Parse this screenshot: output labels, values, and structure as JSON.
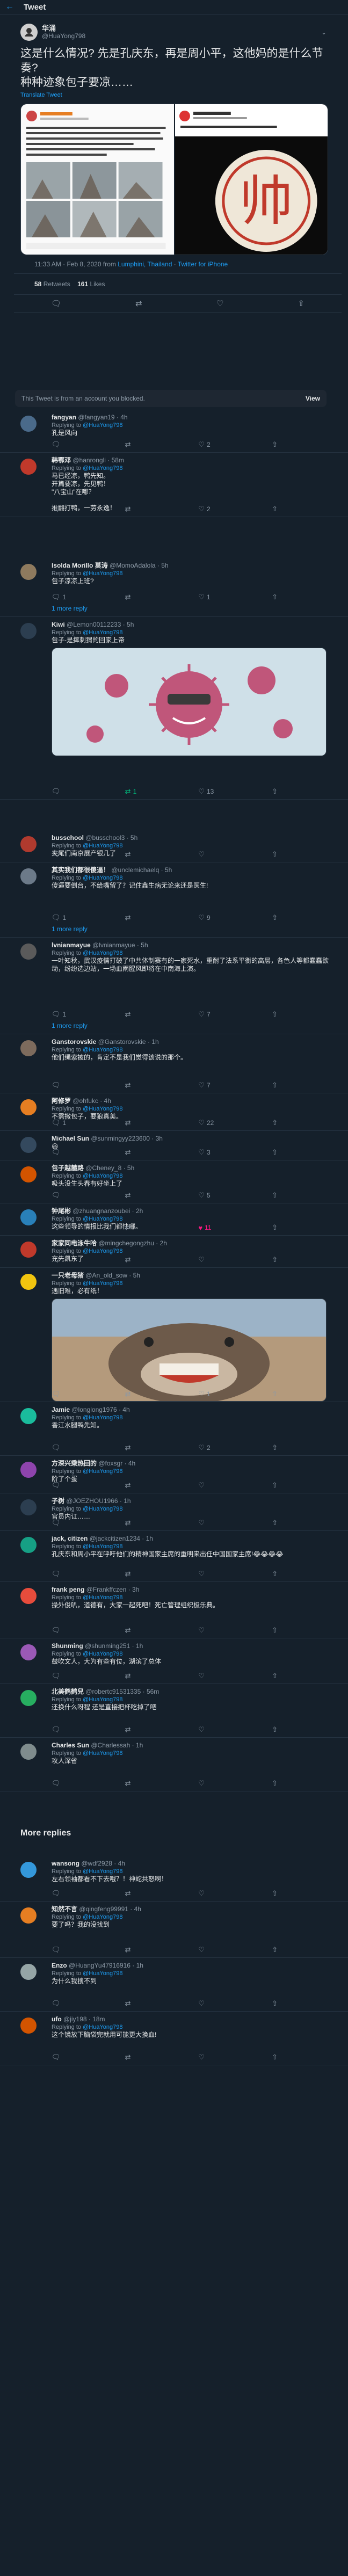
{
  "topbar": {
    "title": "Tweet",
    "back_icon": "arrow-left-icon"
  },
  "main_tweet": {
    "author_name": "华涌",
    "author_handle": "@HuaYong798",
    "text": "这是什么情况? 先是孔庆东，再是周小平，这他妈的是什么节奏?\n种种迹象包子要凉……",
    "translate": "Translate Tweet",
    "timestamp": "11:33 AM · Feb 8, 2020 from",
    "location": "Lumphini, Thailand",
    "source": "Twitter for iPhone",
    "retweets": "58",
    "retweets_label": "Retweets",
    "likes": "161",
    "likes_label": "Likes"
  },
  "blocked": {
    "text": "This Tweet is from an account you blocked.",
    "view": "View"
  },
  "more_replies_title": "More replies",
  "replies": [
    {
      "name": "fangyan",
      "handle": "@fangyan19 · 4h",
      "to": "@HuaYong798",
      "text": "孔是风向",
      "reply": "",
      "rt": "",
      "like": "2",
      "liked": false,
      "rted": false,
      "more": false
    },
    {
      "name": "韩鄂邓",
      "handle": "@hanrongli · 58m",
      "to": "@HuaYong798",
      "text": "马已经凉，鸭先知。\n开篇要凉，先见鸭！\n\"八宝山\"在哪？\n\n推翻打鸭，一劳永逸！",
      "reply": "",
      "rt": "",
      "like": "2",
      "liked": false,
      "rted": false,
      "more": false
    },
    {
      "name": "Isolda Morillo 莫涛",
      "handle": "@MomoAdalola · 5h",
      "to": "@HuaYong798",
      "text": "包子凉凉上班?",
      "reply": "1",
      "rt": "",
      "like": "1",
      "liked": false,
      "rted": false,
      "more": true,
      "more_label": "1 more reply"
    },
    {
      "name": "Kiwi",
      "handle": "@Lemon00112233 · 5h",
      "to": "@HuaYong798",
      "text": "包子-是摔刺猬的回家上帝",
      "reply": "",
      "rt": "1",
      "like": "13",
      "liked": false,
      "rted": true,
      "more": false
    },
    {
      "name": "busschool",
      "handle": "@busschool3 · 5h",
      "to": "@HuaYong798",
      "text": "夹尾们南京展产银几了",
      "reply": "",
      "rt": "",
      "like": "",
      "liked": false,
      "rted": false,
      "more": false
    },
    {
      "name": "其实我们都很傻逼！",
      "handle": "@unclemichaelq · 5h",
      "to": "@HuaYong798",
      "text": "傻逼要倒台，不给嘴留了？记住鑫生病无论来还是医生!",
      "reply": "1",
      "rt": "",
      "like": "9",
      "liked": false,
      "rted": false,
      "more": true,
      "more_label": "1 more reply"
    },
    {
      "name": "lvnianmayue",
      "handle": "@lvnianmayue · 5h",
      "to": "@HuaYong798",
      "text": "一叶知秋，武汉疫情打破了中共体制赛有的一家死水，重耐了法系平衡的高层，各色人等都蠢蠢欲动，纷纷选边站，一场血雨腥风即将在中南海上演。",
      "reply": "1",
      "rt": "",
      "like": "7",
      "liked": false,
      "rted": false,
      "more": true,
      "more_label": "1 more reply"
    },
    {
      "name": "Ganstorovskie",
      "handle": "@Ganstorovskie · 1h",
      "to": "@HuaYong798",
      "text": "他们绳索被的，肯定不是我们觉得该说的那个。",
      "reply": "",
      "rt": "",
      "like": "7",
      "liked": false,
      "rted": false,
      "more": false
    },
    {
      "name": "阿修罗",
      "handle": "@ohfukc · 4h",
      "to": "@HuaYong798",
      "text": "不需撒包子，要狼真美。",
      "reply": "1",
      "rt": "",
      "like": "22",
      "liked": false,
      "rted": false,
      "more": false
    },
    {
      "name": "Michael Sun",
      "handle": "@sunmingyy223600 · 3h",
      "to": "",
      "text": "😃",
      "reply": "",
      "rt": "",
      "like": "3",
      "liked": false,
      "rted": false,
      "more": false
    },
    {
      "name": "包子越麓路",
      "handle": "@Cheney_8 · 5h",
      "to": "@HuaYong798",
      "text": "吸头没生头春有好坐上了",
      "reply": "",
      "rt": "",
      "like": "5",
      "liked": false,
      "rted": false,
      "more": false
    },
    {
      "name": "钟尾彬",
      "handle": "@zhuangnanzoubei · 2h",
      "to": "@HuaYong798",
      "text": "这些领导的情报比我们都快哪。",
      "reply": "",
      "rt": "",
      "like": "11",
      "liked": true,
      "rted": false,
      "more": false
    },
    {
      "name": "家家同电泳牛哈",
      "handle": "@mingchegongzhu · 2h",
      "to": "@HuaYong798",
      "text": "充先凯东了",
      "reply": "",
      "rt": "",
      "like": "",
      "liked": false,
      "rted": false,
      "more": false
    },
    {
      "name": "一只老母猪",
      "handle": "@An_old_sow · 5h",
      "to": "@HuaYong798",
      "text": "遇旧难，必有纸！",
      "reply": "",
      "rt": "",
      "like": "1",
      "liked": false,
      "rted": false,
      "more": false
    },
    {
      "name": "Jamie",
      "handle": "@longlong1976 · 4h",
      "to": "@HuaYong798",
      "text": "香江水腿鸭先知。",
      "reply": "",
      "rt": "",
      "like": "2",
      "liked": false,
      "rted": false,
      "more": false
    },
    {
      "name": "方深兴乘热回的",
      "handle": "@foxsgr · 4h",
      "to": "@HuaYong798",
      "text": "阶了个蛋",
      "reply": "",
      "rt": "",
      "like": "",
      "liked": false,
      "rted": false,
      "more": false
    },
    {
      "name": "子树",
      "handle": "@JOEZHOU1966 · 1h",
      "to": "@HuaYong798",
      "text": "官员内讧……",
      "reply": "",
      "rt": "",
      "like": "",
      "liked": false,
      "rted": false,
      "more": false
    },
    {
      "name": "jack, citizen",
      "handle": "@jackcitizen1234 · 1h",
      "to": "@HuaYong798",
      "text": "孔庆东和周小平在呼吁他们的精神国家主席的重明来出任中国国家主席!😂😂😂😂",
      "reply": "",
      "rt": "",
      "like": "",
      "liked": false,
      "rted": false,
      "more": false
    },
    {
      "name": "frank peng",
      "handle": "@Frankffczen · 3h",
      "to": "@HuaYong798",
      "text": "操外俊叭，道德有，大家一起死吧！死亡管理组织极乐典。",
      "reply": "",
      "rt": "",
      "like": "",
      "liked": false,
      "rted": false,
      "more": false
    },
    {
      "name": "Shunming",
      "handle": "@shunming251 · 1h",
      "to": "@HuaYong798",
      "text": "鼓吹文人，大为有些有位，湖滨了总体",
      "reply": "",
      "rt": "",
      "like": "",
      "liked": false,
      "rted": false,
      "more": false
    },
    {
      "name": "北美鹤鹤兒",
      "handle": "@robertc91531335 · 56m",
      "to": "@HuaYong798",
      "text": "还换什么呀程 还是直接把杯吃掉了吧",
      "reply": "",
      "rt": "",
      "like": "",
      "liked": false,
      "rted": false,
      "more": false
    },
    {
      "name": "Charles Sun",
      "handle": "@Charlessah · 1h",
      "to": "@HuaYong798",
      "text": "攻人深省",
      "reply": "",
      "rt": "",
      "like": "",
      "liked": false,
      "rted": false,
      "more": false
    },
    {
      "name": "wansong",
      "handle": "@wdf2928 · 4h",
      "to": "@HuaYong798",
      "text": "左右领袖都看不下去哦？！神蛇共怒啊！",
      "reply": "",
      "rt": "",
      "like": "",
      "liked": false,
      "rted": false,
      "more": false
    },
    {
      "name": "知然不言",
      "handle": "@qingfeng99991 · 4h",
      "to": "@HuaYong798",
      "text": "要了吗？我的没找到",
      "reply": "",
      "rt": "",
      "like": "",
      "liked": false,
      "rted": false,
      "more": false
    },
    {
      "name": "Enzo",
      "handle": "@HuangYu47916916 · 1h",
      "to": "@HuaYong798",
      "text": "为什么我搜不到",
      "reply": "",
      "rt": "",
      "like": "",
      "liked": false,
      "rted": false,
      "more": false
    },
    {
      "name": "ufo",
      "handle": "@jiy198 · 18m",
      "to": "@HuaYong798",
      "text": "这个镜放下脑袋完就用可能更大换血!",
      "reply": "",
      "rt": "",
      "like": "",
      "liked": false,
      "rted": false,
      "more": false
    }
  ],
  "replying_to_label": "Replying to",
  "icons": {
    "reply": "reply-icon",
    "retweet": "retweet-icon",
    "like": "heart-icon",
    "share": "share-icon"
  },
  "colors": {
    "background": "#15202b",
    "accent": "#1d9bf0",
    "like": "#f91880",
    "retweet": "#00ba7c"
  }
}
